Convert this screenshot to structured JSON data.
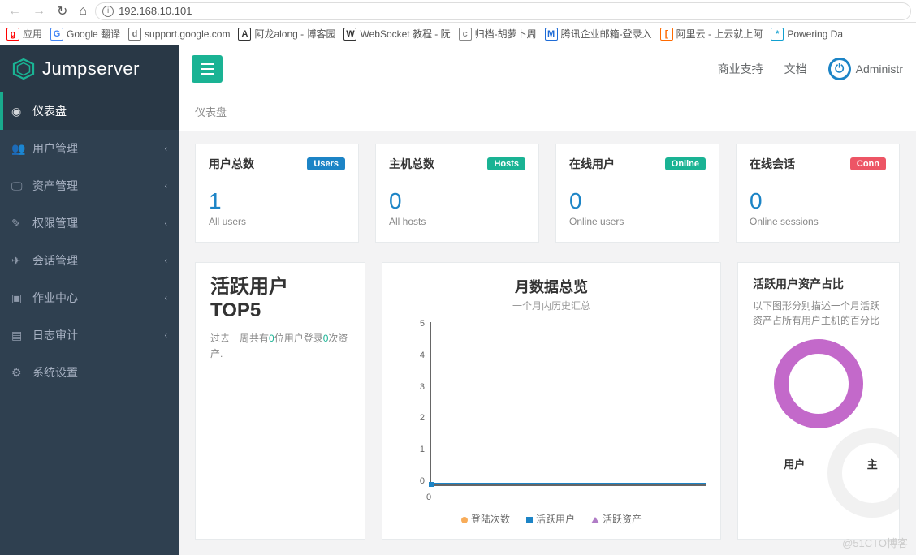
{
  "browser": {
    "url": "192.168.10.101",
    "bookmarks": [
      {
        "icon": "grid",
        "label": "应用",
        "color": "#f00"
      },
      {
        "icon": "G",
        "label": "Google 翻译",
        "color": "#4285f4"
      },
      {
        "icon": "doc",
        "label": "support.google.com",
        "color": "#777"
      },
      {
        "icon": "A",
        "label": "阿龙along - 博客园",
        "color": "#333"
      },
      {
        "icon": "W",
        "label": "WebSocket 教程 - 阮",
        "color": "#333"
      },
      {
        "icon": "cat",
        "label": "归档-胡萝卜周",
        "color": "#888"
      },
      {
        "icon": "M",
        "label": "腾讯企业邮箱-登录入",
        "color": "#1e6bd6"
      },
      {
        "icon": "[-]",
        "label": "阿里云 - 上云就上阿",
        "color": "#ff6a00"
      },
      {
        "icon": "*",
        "label": "Powering Da",
        "color": "#11a0d0"
      }
    ]
  },
  "brand": "Jumpserver",
  "topbar": {
    "links": [
      "商业支持",
      "文档"
    ],
    "user": "Administr"
  },
  "breadcrumb": "仪表盘",
  "sidebar": [
    {
      "icon": "◉",
      "label": "仪表盘",
      "active": true,
      "expandable": false
    },
    {
      "icon": "👥",
      "label": "用户管理",
      "active": false,
      "expandable": true
    },
    {
      "icon": "🖵",
      "label": "资产管理",
      "active": false,
      "expandable": true
    },
    {
      "icon": "✎",
      "label": "权限管理",
      "active": false,
      "expandable": true
    },
    {
      "icon": "✈",
      "label": "会话管理",
      "active": false,
      "expandable": true
    },
    {
      "icon": "▣",
      "label": "作业中心",
      "active": false,
      "expandable": true
    },
    {
      "icon": "▤",
      "label": "日志审计",
      "active": false,
      "expandable": true
    },
    {
      "icon": "⚙",
      "label": "系统设置",
      "active": false,
      "expandable": false
    }
  ],
  "stats": [
    {
      "title": "用户总数",
      "badge": "Users",
      "badgeClass": "users",
      "value": "1",
      "sub": "All users"
    },
    {
      "title": "主机总数",
      "badge": "Hosts",
      "badgeClass": "hosts",
      "value": "0",
      "sub": "All hosts"
    },
    {
      "title": "在线用户",
      "badge": "Online",
      "badgeClass": "online",
      "value": "0",
      "sub": "Online users"
    },
    {
      "title": "在线会话",
      "badge": "Conn",
      "badgeClass": "conn",
      "value": "0",
      "sub": "Online sessions"
    }
  ],
  "top5": {
    "title_line1": "活跃用户",
    "title_line2": "TOP5",
    "desc_pre": "过去一周共有",
    "desc_users": "0",
    "desc_mid": "位用户登录",
    "desc_assets": "0",
    "desc_post": "次资产."
  },
  "chart": {
    "title": "月数据总览",
    "subtitle": "一个月内历史汇总",
    "legend": [
      "登陆次数",
      "活跃用户",
      "活跃资产"
    ]
  },
  "chart_data": {
    "type": "line",
    "title": "月数据总览",
    "subtitle": "一个月内历史汇总",
    "xlabel": "",
    "ylabel": "",
    "ylim": [
      0,
      5
    ],
    "yticks": [
      0,
      1,
      2,
      3,
      4,
      5
    ],
    "x": [
      0
    ],
    "series": [
      {
        "name": "登陆次数",
        "values": [
          0
        ],
        "color": "#f8ac59"
      },
      {
        "name": "活跃用户",
        "values": [
          0
        ],
        "color": "#1c84c6"
      },
      {
        "name": "活跃资产",
        "values": [
          0
        ],
        "color": "#b07cc6"
      }
    ]
  },
  "donut": {
    "title": "活跃用户资产占比",
    "desc": "以下图形分别描述一个月活跃资产占所有用户主机的百分比",
    "caption": "用户",
    "caption2": "主"
  },
  "watermark": "@51CTO博客"
}
